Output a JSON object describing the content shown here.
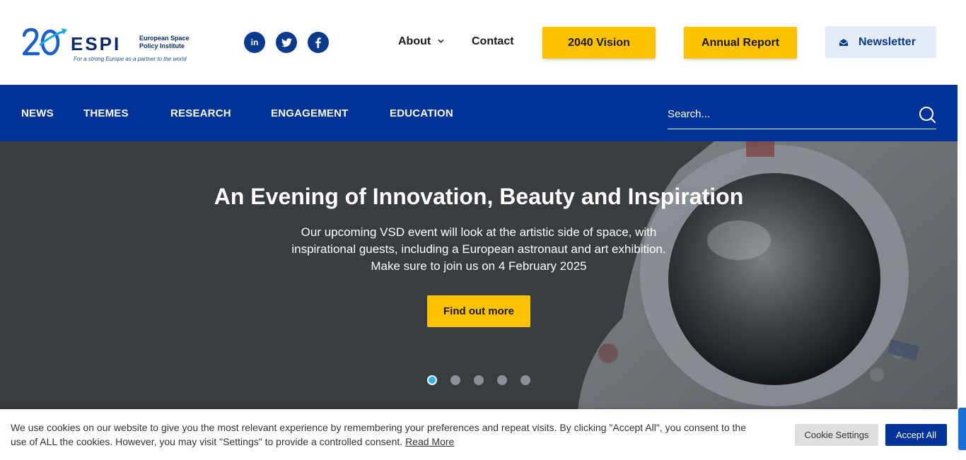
{
  "logo": {
    "name": "ESPI",
    "number": "20",
    "subtitle_line1": "European Space",
    "subtitle_line2": "Policy Institute",
    "tagline": "For a strong Europe as a partner to the world"
  },
  "social": [
    {
      "icon": "linkedin-icon",
      "glyph": "in"
    },
    {
      "icon": "twitter-icon"
    },
    {
      "icon": "facebook-icon"
    }
  ],
  "topnav": {
    "about_label": "About",
    "contact_label": "Contact",
    "vision_label": "2040 Vision",
    "report_label": "Annual Report",
    "newsletter_label": "Newsletter"
  },
  "mainnav": {
    "items": [
      "NEWS",
      "THEMES",
      "RESEARCH",
      "ENGAGEMENT",
      "EDUCATION"
    ],
    "search_placeholder": "Search..."
  },
  "hero": {
    "title": "An Evening of Innovation, Beauty and Inspiration",
    "text_lines": [
      "Our upcoming VSD event will look at the artistic side of space, with",
      "inspirational guests, including a European astronaut and art exhibition.",
      "Make sure to join us on 4 February 2025"
    ],
    "button_label": "Find out more",
    "slide_count": 5,
    "active_slide": 1
  },
  "cookie": {
    "text": "We use cookies on our website to give you the most relevant experience by remembering your preferences and repeat visits. By clicking \"Accept All\", you consent to the use of ALL the cookies. However, you may visit \"Settings\" to provide a controlled consent.",
    "read_more": "Read More",
    "settings_label": "Cookie Settings",
    "accept_label": "Accept All"
  },
  "colors": {
    "brand_blue": "#003399",
    "accent_yellow": "#fcc200",
    "dot_active": "#2ab5e8",
    "hero_bg": "#393c41"
  }
}
